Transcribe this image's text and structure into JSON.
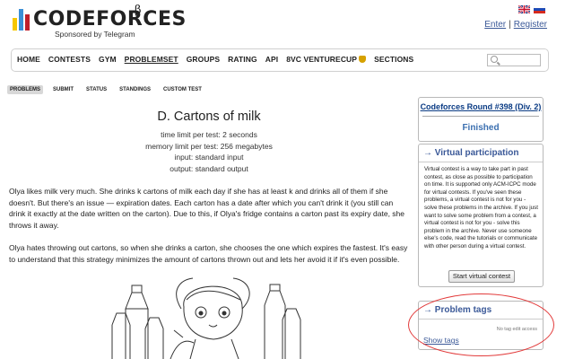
{
  "header": {
    "logo_text": "CODEFORCES",
    "beta_mark": "β",
    "sponsor": "Sponsored by Telegram",
    "logo_colors": [
      "#f6c700",
      "#3b8fd6",
      "#c01f2a"
    ],
    "enter": "Enter",
    "separator": "|",
    "register": "Register",
    "flags": [
      "english-flag",
      "russian-flag"
    ]
  },
  "menu": {
    "items": [
      "HOME",
      "CONTESTS",
      "GYM",
      "PROBLEMSET",
      "GROUPS",
      "RATING",
      "API",
      "8VC VENTURECUP",
      "SECTIONS"
    ],
    "active": "PROBLEMSET"
  },
  "submenu": {
    "items": [
      "PROBLEMS",
      "SUBMIT",
      "STATUS",
      "STANDINGS",
      "CUSTOM TEST"
    ],
    "active": "PROBLEMS"
  },
  "problem": {
    "title": "D. Cartons of milk",
    "time_limit": "time limit per test: 2 seconds",
    "memory_limit": "memory limit per test: 256 megabytes",
    "input": "input: standard input",
    "output": "output: standard output",
    "paragraph1": "Olya likes milk very much. She drinks k cartons of milk each day if she has at least k and drinks all of them if she doesn't. But there's an issue — expiration dates. Each carton has a date after which you can't drink it (you still can drink it exactly at the date written on the carton). Due to this, if Olya's fridge contains a carton past its expiry date, she throws it away.",
    "paragraph2": "Olya hates throwing out cartons, so when she drinks a carton, she chooses the one which expires the fastest. It's easy to understand that this strategy minimizes the amount of cartons thrown out and lets her avoid it if it's even possible."
  },
  "sidebar": {
    "contest_name": "Codeforces Round #398 (Div. 2)",
    "contest_status": "Finished",
    "virtual": {
      "title": "→ Virtual participation",
      "text": "Virtual contest is a way to take part in past contest, as close as possible to participation on time. It is supported only ACM-ICPC mode for virtual contests. If you've seen these problems, a virtual contest is not for you - solve these problems in the archive. If you just want to solve some problem from a contest, a virtual contest is not for you - solve this problem in the archive. Never use someone else's code, read the tutorials or communicate with other person during a virtual contest.",
      "button": "Start virtual contest"
    },
    "tags": {
      "title": "→ Problem tags",
      "access_note": "No tag edit access",
      "show_tags": "Show tags"
    }
  },
  "annotation_color": "#e23b3b"
}
